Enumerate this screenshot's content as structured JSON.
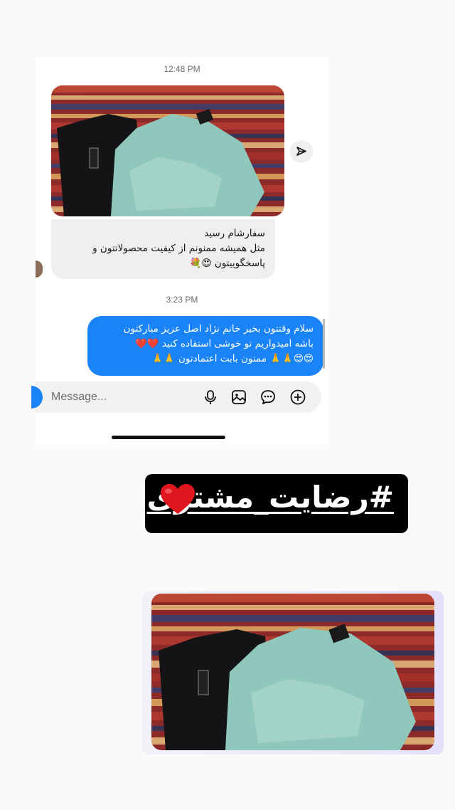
{
  "chat": {
    "timestamp_1": "12:48 PM",
    "timestamp_2": "3:23 PM",
    "received_message": {
      "line1": "سفارشام رسید",
      "line2": "مثل همیشه ممنونم از کیفیت محصولاتتون و",
      "line3": "پاسخگوییتون 😍💐"
    },
    "sent_message": {
      "line1": "سلام وقتتون بخیر خانم نژاد اصل عزیز مبارکتون",
      "line2": "باشه امیدواریم تو خوشی استفاده کنید ❤️❤️",
      "line3": "😍😍🙏🙏 ممنون بابت اعتمادتون 🙏🙏"
    },
    "composer": {
      "placeholder": "Message..."
    },
    "icons": {
      "share": "send-icon",
      "camera": "camera-icon",
      "mic": "microphone-icon",
      "gallery": "gallery-icon",
      "sticker": "sticker-icon",
      "add": "plus-circle-icon"
    },
    "colors": {
      "sent_bubble": "#1a83f7",
      "received_bubble": "#efefef"
    }
  },
  "title_sticker": {
    "text": "#رضایت_مشتری",
    "heart_icon": "red-heart-icon",
    "heart_color": "#e0161f"
  }
}
